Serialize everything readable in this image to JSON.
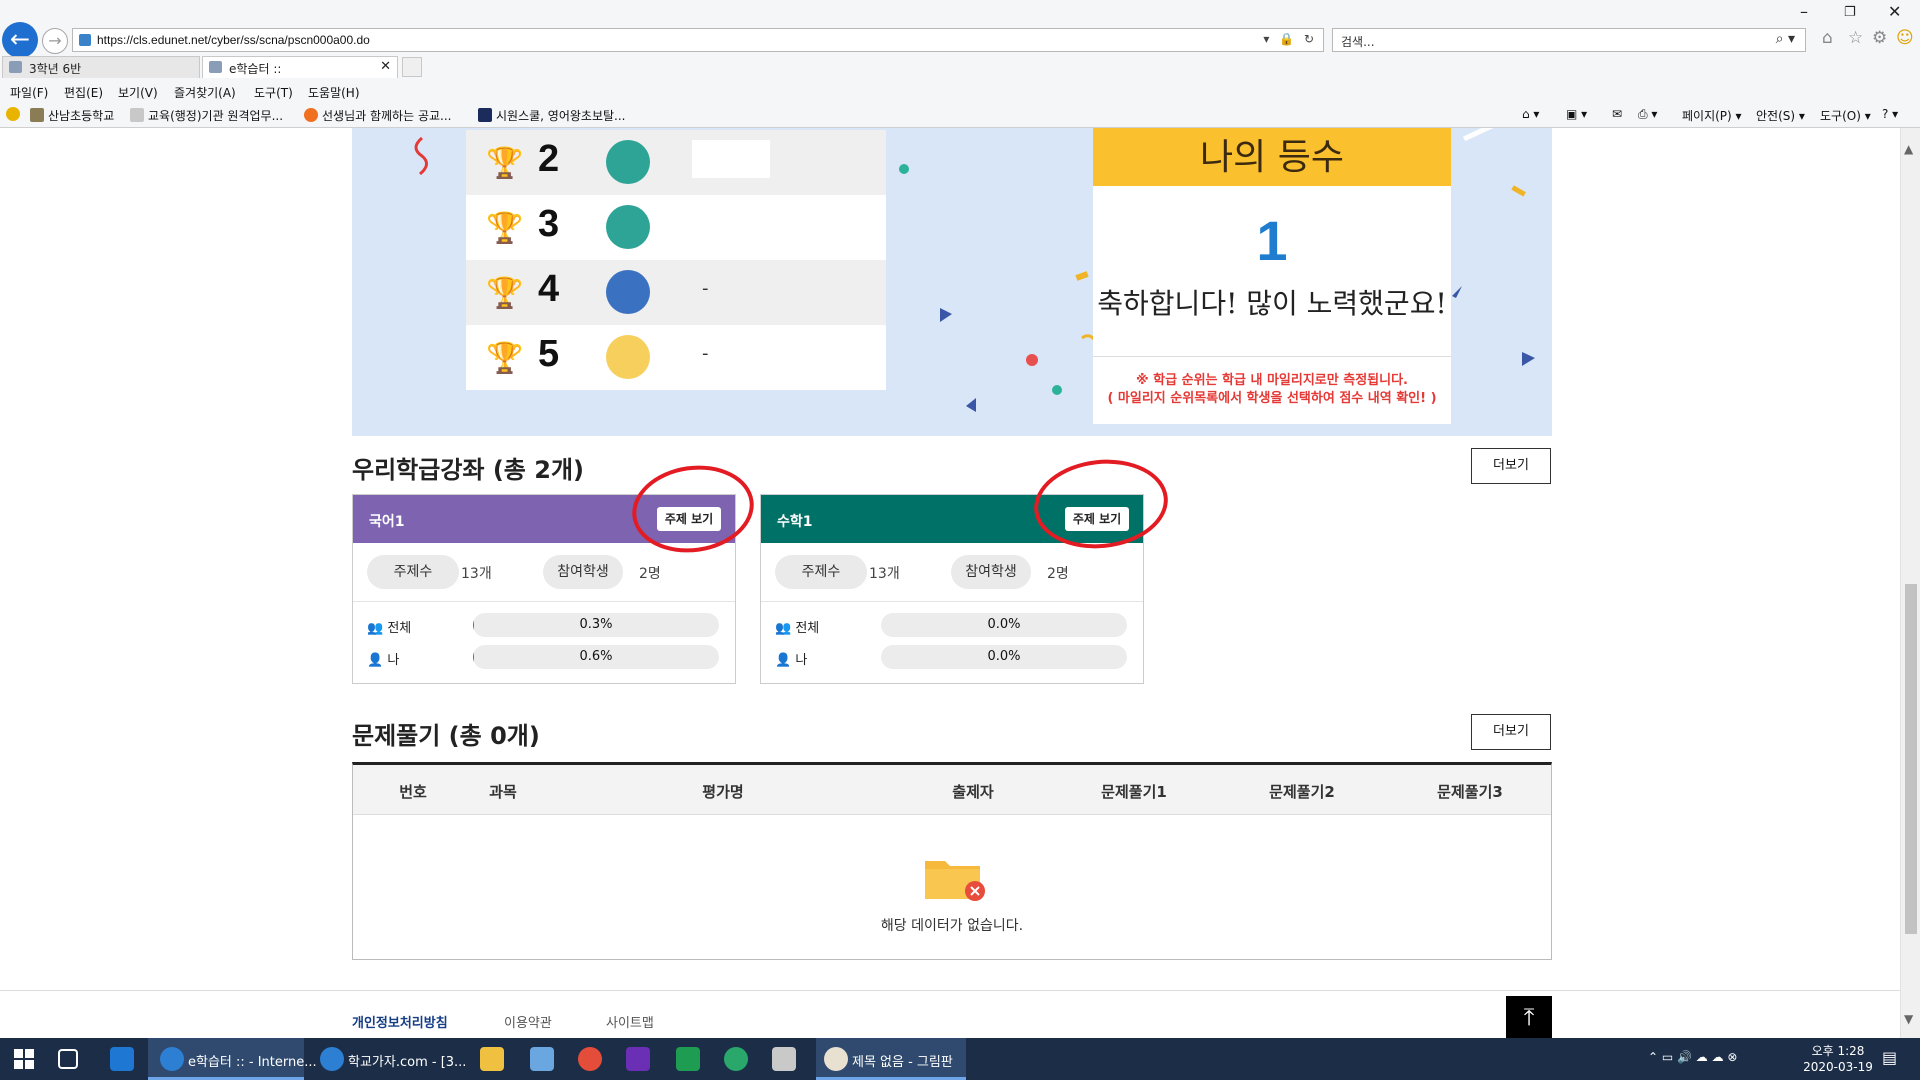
{
  "browser": {
    "url": "https://cls.edunet.net/cyber/ss/scna/pscn000a00.do",
    "search_placeholder": "검색...",
    "tabs": [
      {
        "label": "3학년 6반"
      },
      {
        "label": "e학습터 ::"
      }
    ],
    "menu": [
      "파일(F)",
      "편집(E)",
      "보기(V)",
      "즐겨찾기(A)",
      "도구(T)",
      "도움말(H)"
    ],
    "favorites": [
      "산남초등학교",
      "교육(행정)기관 원격업무...",
      "선생님과 함께하는 공교...",
      "시원스쿨, 영어왕초보탈..."
    ],
    "commands": [
      "페이지(P)",
      "안전(S)",
      "도구(O)"
    ]
  },
  "ranking": {
    "rows": [
      {
        "rank": "2",
        "name": ""
      },
      {
        "rank": "3",
        "name": ""
      },
      {
        "rank": "4",
        "name": "-"
      },
      {
        "rank": "5",
        "name": "-"
      }
    ],
    "my_rank_title": "나의 등수",
    "my_rank": "1",
    "congrats": "축하합니다! 많이 노력했군요!",
    "note_line1": "※ 학급 순위는 학급 내 마일리지로만 측정됩니다.",
    "note_line2": "( 마일리지 순위목록에서 학생을 선택하여 점수 내역 확인! )"
  },
  "courses": {
    "title": "우리학급강좌 (총 2개)",
    "more": "더보기",
    "items": [
      {
        "name": "국어1",
        "topic_btn": "주제 보기",
        "topics_label": "주제수",
        "topics": "13개",
        "students_label": "참여학생",
        "students": "2명",
        "all_label": "전체",
        "all_pct": "0.3%",
        "all_frac": 0.003,
        "me_label": "나",
        "me_pct": "0.6%",
        "me_frac": 0.006,
        "color": "#7e64b0"
      },
      {
        "name": "수학1",
        "topic_btn": "주제 보기",
        "topics_label": "주제수",
        "topics": "13개",
        "students_label": "참여학생",
        "students": "2명",
        "all_label": "전체",
        "all_pct": "0.0%",
        "all_frac": 0.0,
        "me_label": "나",
        "me_pct": "0.0%",
        "me_frac": 0.0,
        "color": "#007166"
      }
    ]
  },
  "problems": {
    "title": "문제풀기 (총 0개)",
    "more": "더보기",
    "columns": [
      "번호",
      "과목",
      "평가명",
      "출제자",
      "문제풀기1",
      "문제풀기2",
      "문제풀기3"
    ],
    "empty": "해당 데이터가 없습니다."
  },
  "footer": {
    "links": [
      "개인정보처리방침",
      "이용약관",
      "사이트맵"
    ]
  },
  "taskbar": {
    "items": [
      "e학습터 :: - Interne...",
      "학교가자.com - [3...",
      "제목 없음 - 그림판"
    ],
    "time": "오후 1:28",
    "date": "2020-03-19"
  }
}
